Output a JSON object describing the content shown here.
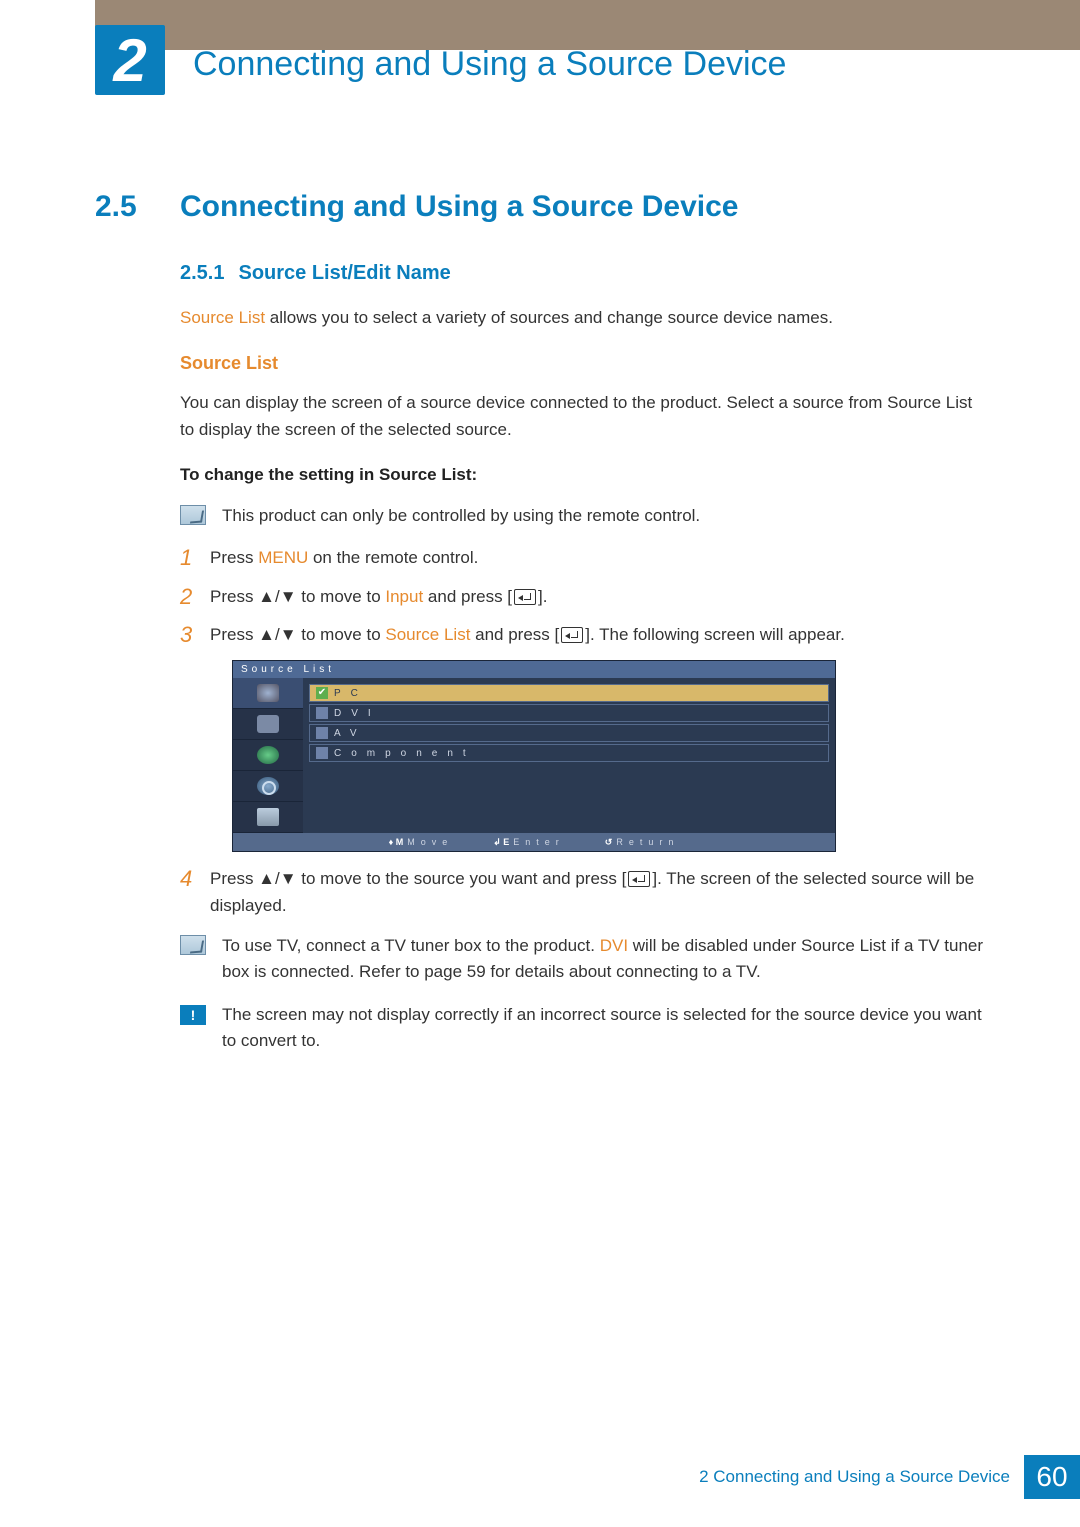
{
  "chapter": {
    "number": "2",
    "title": "Connecting and Using a Source Device"
  },
  "section": {
    "number": "2.5",
    "title": "Connecting and Using a Source Device"
  },
  "subsection": {
    "number": "2.5.1",
    "title": "Source List/Edit Name"
  },
  "intro": {
    "lead_orange": "Source List",
    "lead_rest": " allows you to select a variety of sources and change source device names."
  },
  "h4a": "Source List",
  "para1": "You can display the screen of a source device connected to the product. Select a source from Source List to display the screen of the selected source.",
  "boldline": "To change the setting in Source List:",
  "note1": "This product can only be controlled by using the remote control.",
  "steps": {
    "s1_a": "Press ",
    "s1_menu": "MENU",
    "s1_b": " on the remote control.",
    "s2_a": "Press  ▲/▼  to move to ",
    "s2_input": "Input",
    "s2_b": " and press [",
    "s2_c": "].",
    "s3_a": "Press  ▲/▼  to move to ",
    "s3_src": "Source List",
    "s3_b": " and press [",
    "s3_c": "]. The following screen will appear.",
    "s4_a": "Press  ▲/▼  to move to the source you want and press [",
    "s4_b": "]. The screen of the selected source will be displayed."
  },
  "osd": {
    "title": "Source List",
    "rows": {
      "r1_label": "PC",
      "r2_label": "DVI",
      "r3_label": "AV",
      "r4_label": "Component"
    },
    "footer": {
      "move": "Move",
      "enter": "Enter",
      "return": "Return"
    }
  },
  "note2_a": "To use TV, connect a TV tuner box to the product. ",
  "note2_dvi": "DVI",
  "note2_b": " will be disabled under Source List if a TV tuner box is connected. Refer to page 59 for details about connecting to a TV.",
  "warn1": "The screen may not display correctly if an incorrect source is selected for the source device you want to convert to.",
  "footer": {
    "text": "2 Connecting and Using a Source Device",
    "page": "60"
  }
}
